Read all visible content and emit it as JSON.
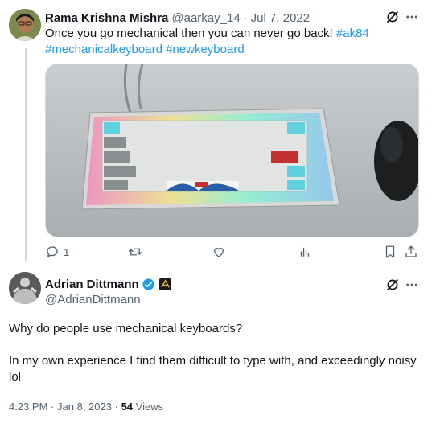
{
  "colors": {
    "text": "#0f1419",
    "muted": "#536471",
    "link": "#1d9bf0",
    "verified": "#1d9bf0",
    "border": "#cfd9de"
  },
  "reply_to": {
    "author_name": "Rama Krishna Mishra",
    "handle": "@aarkay_14",
    "separator": "·",
    "date": "Jul 7, 2022",
    "text_line1": "Once you go mechanical then you can never go back! ",
    "hashtags": [
      "#ak84",
      "#mechanicalkeyboard",
      "#newkeyboard"
    ],
    "actions": {
      "replies": "1",
      "reposts": "",
      "likes": "",
      "views": ""
    }
  },
  "main_tweet": {
    "author_name": "Adrian Dittmann",
    "handle": "@AdrianDittmann",
    "paragraph1": "Why do people use mechanical keyboards?",
    "paragraph2": "In my own experience I find them difficult to type with, and exceedingly noisy lol",
    "time": "4:23 PM",
    "separator": "·",
    "date": "Jan 8, 2023",
    "views_count": "54",
    "views_label": "Views"
  },
  "icons": [
    "grok-icon",
    "more-icon",
    "reply-icon",
    "repost-icon",
    "like-icon",
    "views-icon",
    "bookmark-icon",
    "share-icon",
    "verified-badge-icon",
    "affiliate-badge-icon"
  ]
}
